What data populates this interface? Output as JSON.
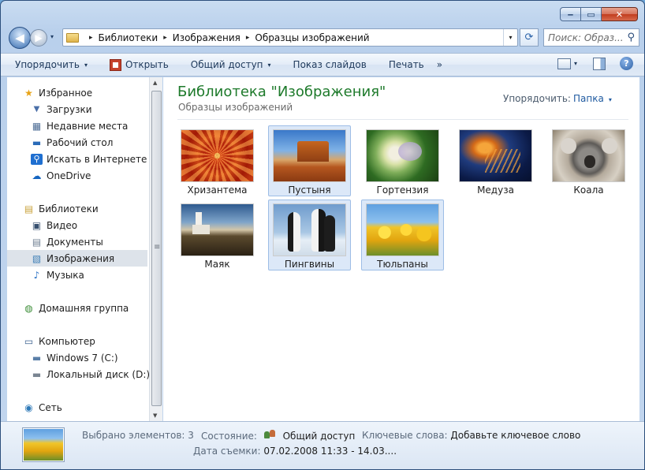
{
  "window": {
    "caption": {
      "minimize": "‒",
      "maximize": "▭",
      "close": "✕"
    }
  },
  "nav": {
    "back_glyph": "◀",
    "forward_glyph": "▶",
    "history_glyph": "▾",
    "breadcrumbs": [
      "Библиотеки",
      "Изображения",
      "Образцы изображений"
    ],
    "crumb_separator": "▸",
    "address_drop_glyph": "▾",
    "refresh_glyph": "⟳",
    "search_placeholder": "Поиск: Образ...",
    "search_glyph": "⚲"
  },
  "toolbar": {
    "organize": "Упорядочить",
    "open": "Открыть",
    "share": "Общий доступ",
    "slideshow": "Показ слайдов",
    "print": "Печать",
    "more": "»",
    "dropdown_glyph": "▾",
    "help_glyph": "?"
  },
  "sidebar": {
    "items": [
      {
        "label": "Избранное",
        "icon": "star-icon",
        "glyph": "★",
        "color": "#e8a317"
      },
      {
        "label": "Загрузки",
        "icon": "downloads-icon",
        "glyph": "▼",
        "color": "#4a6fa8"
      },
      {
        "label": "Недавние места",
        "icon": "recent-places-icon",
        "glyph": "▦",
        "color": "#4c6c95"
      },
      {
        "label": "Рабочий стол",
        "icon": "desktop-icon",
        "glyph": "▬",
        "color": "#2a6bb8"
      },
      {
        "label": "Искать в Интернете",
        "icon": "web-search-icon",
        "glyph": "⚲",
        "color": "#1f6fd0"
      },
      {
        "label": "OneDrive",
        "icon": "onedrive-icon",
        "glyph": "☁",
        "color": "#1565c0"
      },
      {
        "label": "Библиотеки",
        "icon": "libraries-icon",
        "glyph": "▤",
        "color": "#c9a23b"
      },
      {
        "label": "Видео",
        "icon": "video-icon",
        "glyph": "▣",
        "color": "#37506f"
      },
      {
        "label": "Документы",
        "icon": "documents-icon",
        "glyph": "▤",
        "color": "#6f7f93"
      },
      {
        "label": "Изображения",
        "icon": "pictures-icon",
        "glyph": "▧",
        "color": "#3f7fb6"
      },
      {
        "label": "Музыка",
        "icon": "music-icon",
        "glyph": "♪",
        "color": "#2d73c6"
      },
      {
        "label": "Домашняя группа",
        "icon": "homegroup-icon",
        "glyph": "◍",
        "color": "#3f8f3a"
      },
      {
        "label": "Компьютер",
        "icon": "computer-icon",
        "glyph": "▭",
        "color": "#3a5f8f"
      },
      {
        "label": "Windows 7 (C:)",
        "icon": "drive-c-icon",
        "glyph": "▬",
        "color": "#5a7fa8"
      },
      {
        "label": "Локальный диск (D:)",
        "icon": "drive-d-icon",
        "glyph": "▬",
        "color": "#7a8592"
      },
      {
        "label": "Сеть",
        "icon": "network-icon",
        "glyph": "◉",
        "color": "#2f7ab8"
      }
    ],
    "scroll_up": "▲",
    "scroll_down": "▼"
  },
  "content": {
    "library_title": "Библиотека \"Изображения\"",
    "library_subtitle": "Образцы изображений",
    "arrange_label": "Упорядочить:",
    "arrange_value": "Папка",
    "files": [
      {
        "name": "Хризантема",
        "selected": false,
        "icon": "chrysanthemum-image"
      },
      {
        "name": "Пустыня",
        "selected": true,
        "icon": "desert-image"
      },
      {
        "name": "Гортензия",
        "selected": false,
        "icon": "hydrangeas-image"
      },
      {
        "name": "Медуза",
        "selected": false,
        "icon": "jellyfish-image"
      },
      {
        "name": "Коала",
        "selected": false,
        "icon": "koala-image"
      },
      {
        "name": "Маяк",
        "selected": false,
        "icon": "lighthouse-image"
      },
      {
        "name": "Пингвины",
        "selected": true,
        "icon": "penguins-image"
      },
      {
        "name": "Тюльпаны",
        "selected": true,
        "icon": "tulips-image"
      }
    ]
  },
  "details": {
    "selected_count_label": "Выбрано элементов: 3",
    "state_label": "Состояние:",
    "state_value": "Общий доступ",
    "keywords_label": "Ключевые слова:",
    "keywords_value": "Добавьте ключевое слово",
    "date_label": "Дата съемки:",
    "date_value": "07.02.2008 11:33 - 14.03...."
  },
  "colors": {
    "library_title": "#1e7a2b",
    "selection_bg": "#dce8f8",
    "selection_border": "#9dbde6",
    "link_blue": "#1f5aa0"
  }
}
